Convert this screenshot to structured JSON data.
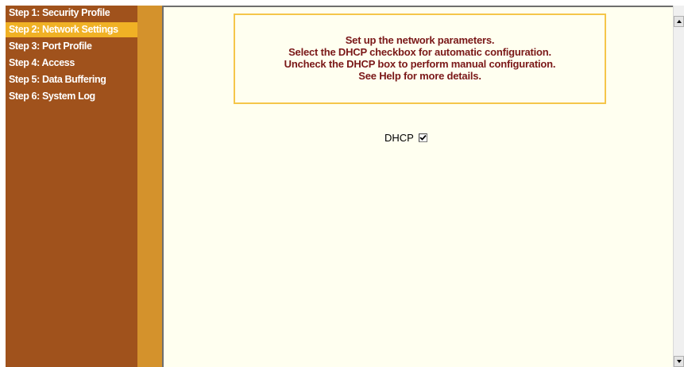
{
  "sidebar": {
    "items": [
      {
        "label": "Step 1: Security Profile",
        "active": false
      },
      {
        "label": "Step 2: Network Settings",
        "active": true
      },
      {
        "label": "Step 3: Port Profile",
        "active": false
      },
      {
        "label": "Step 4: Access",
        "active": false
      },
      {
        "label": "Step 5: Data Buffering",
        "active": false
      },
      {
        "label": "Step 6: System Log",
        "active": false
      }
    ]
  },
  "info": {
    "lines": [
      "Set up the network parameters.",
      "Select the DHCP checkbox for automatic configuration.",
      "Uncheck the DHCP box to perform manual configuration.",
      "See Help for more details."
    ]
  },
  "dhcp": {
    "label": "DHCP",
    "checked": true
  },
  "colors": {
    "sidebar_bg": "#a0521c",
    "sidebar_active_bg": "#f0b125",
    "divider": "#d4922c",
    "content_bg": "#fffff0",
    "info_border": "#f5c64a",
    "info_text": "#7a1818"
  },
  "icons": {
    "scroll_up": "scroll-up-arrow-icon",
    "scroll_down": "scroll-down-arrow-icon",
    "checkmark": "checkmark-icon"
  }
}
